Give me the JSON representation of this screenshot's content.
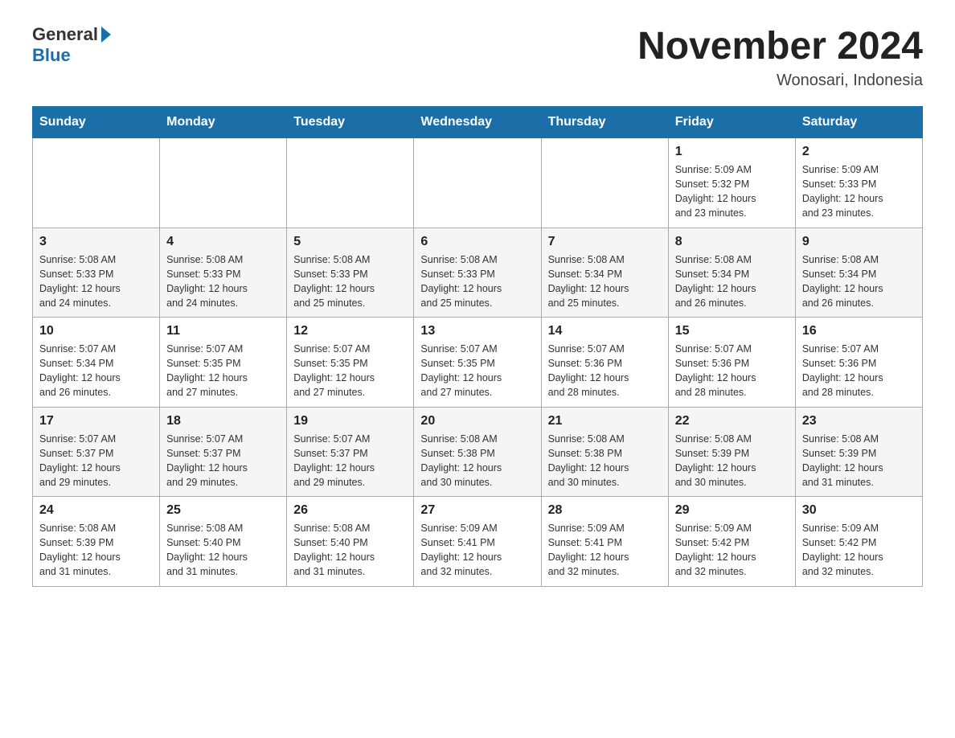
{
  "header": {
    "logo_general": "General",
    "logo_blue": "Blue",
    "month_title": "November 2024",
    "location": "Wonosari, Indonesia"
  },
  "weekdays": [
    "Sunday",
    "Monday",
    "Tuesday",
    "Wednesday",
    "Thursday",
    "Friday",
    "Saturday"
  ],
  "weeks": [
    [
      {
        "day": "",
        "info": ""
      },
      {
        "day": "",
        "info": ""
      },
      {
        "day": "",
        "info": ""
      },
      {
        "day": "",
        "info": ""
      },
      {
        "day": "",
        "info": ""
      },
      {
        "day": "1",
        "info": "Sunrise: 5:09 AM\nSunset: 5:32 PM\nDaylight: 12 hours\nand 23 minutes."
      },
      {
        "day": "2",
        "info": "Sunrise: 5:09 AM\nSunset: 5:33 PM\nDaylight: 12 hours\nand 23 minutes."
      }
    ],
    [
      {
        "day": "3",
        "info": "Sunrise: 5:08 AM\nSunset: 5:33 PM\nDaylight: 12 hours\nand 24 minutes."
      },
      {
        "day": "4",
        "info": "Sunrise: 5:08 AM\nSunset: 5:33 PM\nDaylight: 12 hours\nand 24 minutes."
      },
      {
        "day": "5",
        "info": "Sunrise: 5:08 AM\nSunset: 5:33 PM\nDaylight: 12 hours\nand 25 minutes."
      },
      {
        "day": "6",
        "info": "Sunrise: 5:08 AM\nSunset: 5:33 PM\nDaylight: 12 hours\nand 25 minutes."
      },
      {
        "day": "7",
        "info": "Sunrise: 5:08 AM\nSunset: 5:34 PM\nDaylight: 12 hours\nand 25 minutes."
      },
      {
        "day": "8",
        "info": "Sunrise: 5:08 AM\nSunset: 5:34 PM\nDaylight: 12 hours\nand 26 minutes."
      },
      {
        "day": "9",
        "info": "Sunrise: 5:08 AM\nSunset: 5:34 PM\nDaylight: 12 hours\nand 26 minutes."
      }
    ],
    [
      {
        "day": "10",
        "info": "Sunrise: 5:07 AM\nSunset: 5:34 PM\nDaylight: 12 hours\nand 26 minutes."
      },
      {
        "day": "11",
        "info": "Sunrise: 5:07 AM\nSunset: 5:35 PM\nDaylight: 12 hours\nand 27 minutes."
      },
      {
        "day": "12",
        "info": "Sunrise: 5:07 AM\nSunset: 5:35 PM\nDaylight: 12 hours\nand 27 minutes."
      },
      {
        "day": "13",
        "info": "Sunrise: 5:07 AM\nSunset: 5:35 PM\nDaylight: 12 hours\nand 27 minutes."
      },
      {
        "day": "14",
        "info": "Sunrise: 5:07 AM\nSunset: 5:36 PM\nDaylight: 12 hours\nand 28 minutes."
      },
      {
        "day": "15",
        "info": "Sunrise: 5:07 AM\nSunset: 5:36 PM\nDaylight: 12 hours\nand 28 minutes."
      },
      {
        "day": "16",
        "info": "Sunrise: 5:07 AM\nSunset: 5:36 PM\nDaylight: 12 hours\nand 28 minutes."
      }
    ],
    [
      {
        "day": "17",
        "info": "Sunrise: 5:07 AM\nSunset: 5:37 PM\nDaylight: 12 hours\nand 29 minutes."
      },
      {
        "day": "18",
        "info": "Sunrise: 5:07 AM\nSunset: 5:37 PM\nDaylight: 12 hours\nand 29 minutes."
      },
      {
        "day": "19",
        "info": "Sunrise: 5:07 AM\nSunset: 5:37 PM\nDaylight: 12 hours\nand 29 minutes."
      },
      {
        "day": "20",
        "info": "Sunrise: 5:08 AM\nSunset: 5:38 PM\nDaylight: 12 hours\nand 30 minutes."
      },
      {
        "day": "21",
        "info": "Sunrise: 5:08 AM\nSunset: 5:38 PM\nDaylight: 12 hours\nand 30 minutes."
      },
      {
        "day": "22",
        "info": "Sunrise: 5:08 AM\nSunset: 5:39 PM\nDaylight: 12 hours\nand 30 minutes."
      },
      {
        "day": "23",
        "info": "Sunrise: 5:08 AM\nSunset: 5:39 PM\nDaylight: 12 hours\nand 31 minutes."
      }
    ],
    [
      {
        "day": "24",
        "info": "Sunrise: 5:08 AM\nSunset: 5:39 PM\nDaylight: 12 hours\nand 31 minutes."
      },
      {
        "day": "25",
        "info": "Sunrise: 5:08 AM\nSunset: 5:40 PM\nDaylight: 12 hours\nand 31 minutes."
      },
      {
        "day": "26",
        "info": "Sunrise: 5:08 AM\nSunset: 5:40 PM\nDaylight: 12 hours\nand 31 minutes."
      },
      {
        "day": "27",
        "info": "Sunrise: 5:09 AM\nSunset: 5:41 PM\nDaylight: 12 hours\nand 32 minutes."
      },
      {
        "day": "28",
        "info": "Sunrise: 5:09 AM\nSunset: 5:41 PM\nDaylight: 12 hours\nand 32 minutes."
      },
      {
        "day": "29",
        "info": "Sunrise: 5:09 AM\nSunset: 5:42 PM\nDaylight: 12 hours\nand 32 minutes."
      },
      {
        "day": "30",
        "info": "Sunrise: 5:09 AM\nSunset: 5:42 PM\nDaylight: 12 hours\nand 32 minutes."
      }
    ]
  ]
}
